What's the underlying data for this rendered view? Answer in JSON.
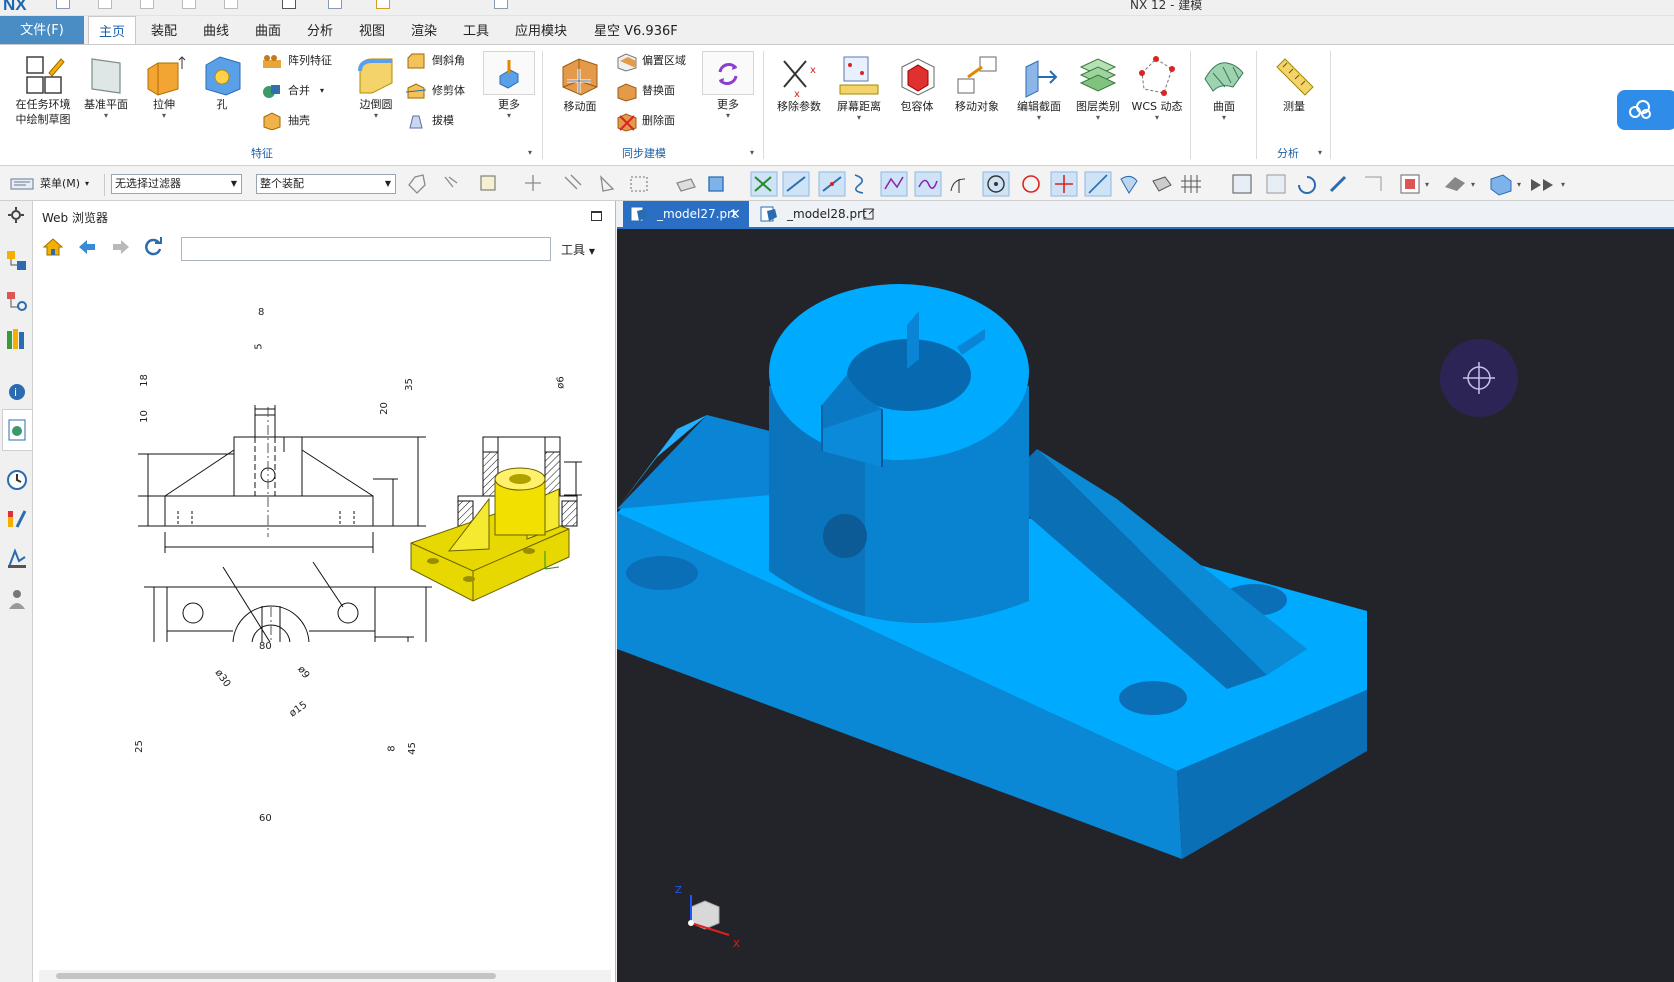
{
  "window": {
    "app_logo": "NX",
    "title": "NX 12 - 建模"
  },
  "file_tab": "文件(F)",
  "menu_tabs": [
    {
      "label": "主页",
      "active": true
    },
    {
      "label": "装配"
    },
    {
      "label": "曲线"
    },
    {
      "label": "曲面"
    },
    {
      "label": "分析"
    },
    {
      "label": "视图"
    },
    {
      "label": "渲染"
    },
    {
      "label": "工具"
    },
    {
      "label": "应用模块"
    },
    {
      "label": "星空 V6.936F"
    }
  ],
  "ribbon": {
    "feature": {
      "sketch": "在任务环境\n中绘制草图",
      "datum_plane": "基准平面",
      "extrude": "拉伸",
      "hole": "孔",
      "pattern": "阵列特征",
      "unite": "合并",
      "shell": "抽壳",
      "edge_blend": "边倒圆",
      "chamfer": "倒斜角",
      "trim_body": "修剪体",
      "draft": "拔模",
      "more": "更多",
      "group_label": "特征"
    },
    "sync": {
      "move_face": "移动面",
      "offset_region": "偏置区域",
      "replace_face": "替换面",
      "delete_face": "删除面",
      "more": "更多",
      "group_label": "同步建模"
    },
    "misc": {
      "remove_params": "移除参数",
      "screen_distance": "屏幕距离",
      "bounding_body": "包容体",
      "move_object": "移动对象",
      "edit_section": "编辑截面",
      "layer_category": "图层类别",
      "wcs_dynamic": "WCS 动态",
      "surface": "曲面",
      "measure": "测量",
      "analysis_group": "分析"
    }
  },
  "toolbar": {
    "menu": "菜单(M)",
    "filter": "无选择过滤器",
    "scope": "整个装配"
  },
  "panel": {
    "title": "Web 浏览器",
    "url": "",
    "tools": "工具"
  },
  "drawing_dims": {
    "d8": "8",
    "d5": "5",
    "d18": "18",
    "d10": "10",
    "d20": "20",
    "d35": "35",
    "d80": "80",
    "d6": "ø6",
    "d30": "ø30",
    "d15": "ø15",
    "d25": "25",
    "d45": "45",
    "d60": "60",
    "d8b": "8",
    "d9": "ø9"
  },
  "doc_tabs": [
    {
      "label": "_model27.prt",
      "active": true
    },
    {
      "label": "_model28.prt",
      "active": false
    }
  ],
  "triad": {
    "z": "Z",
    "x": "X"
  },
  "colors": {
    "model_blue": "#00aaff",
    "viewport_bg": "#222429",
    "accent": "#2a6fc4",
    "iso_yellow": "#f2e600"
  }
}
